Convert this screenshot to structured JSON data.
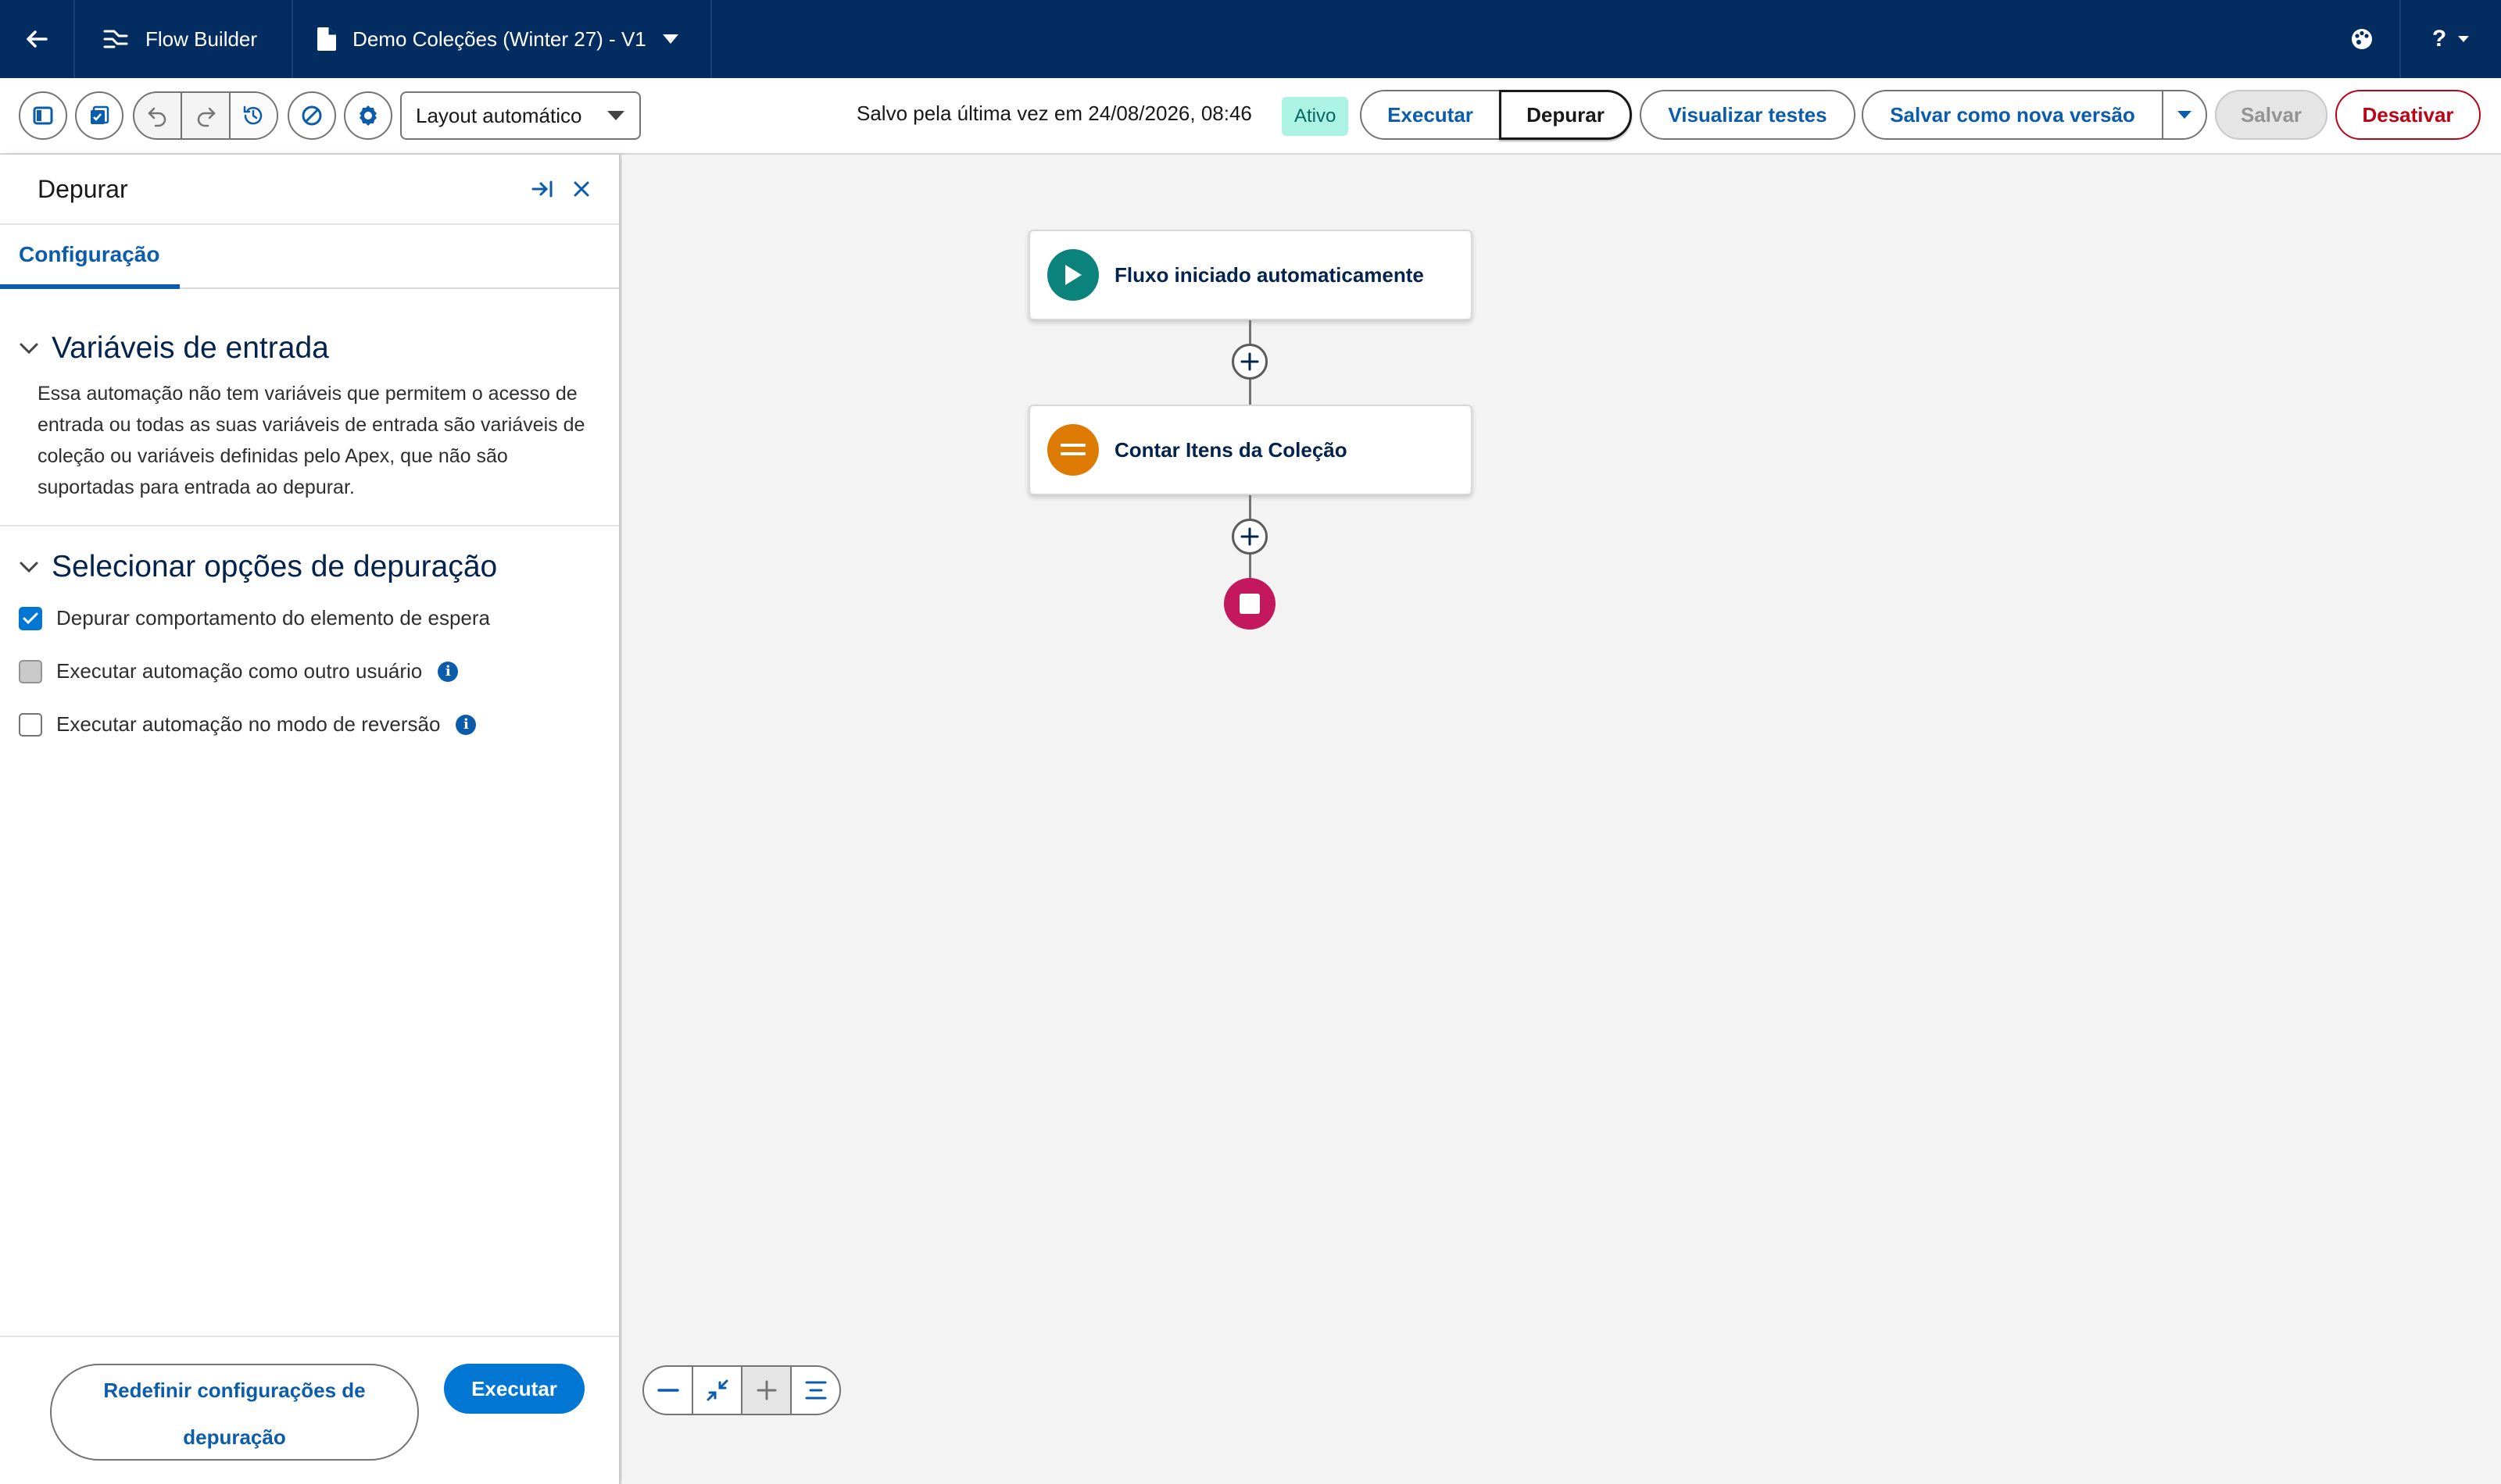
{
  "topbar": {
    "app_name": "Flow Builder",
    "flow_name": "Demo Coleções (Winter 27) - V1",
    "help_label": "?"
  },
  "toolbar": {
    "layout_select": "Layout automático",
    "saved_text": "Salvo pela última vez em 24/08/2026, 08:46",
    "status_badge": "Ativo",
    "run_label": "Executar",
    "debug_label": "Depurar",
    "view_tests_label": "Visualizar testes",
    "save_new_version_label": "Salvar como nova versão",
    "save_label": "Salvar",
    "deactivate_label": "Desativar"
  },
  "panel": {
    "title": "Depurar",
    "tab_label": "Configuração",
    "input_vars_title": "Variáveis de entrada",
    "input_vars_text": "Essa automação não tem variáveis que permitem o acesso de entrada ou todas as suas variáveis de entrada são variáveis de coleção ou variáveis definidas pelo Apex, que não são suportadas para entrada ao depurar.",
    "debug_options_title": "Selecionar opções de depuração",
    "options": [
      {
        "label": "Depurar comportamento do elemento de espera",
        "checked": true
      },
      {
        "label": "Executar automação como outro usuário",
        "checked": false
      },
      {
        "label": "Executar automação no modo de reversão",
        "checked": false
      }
    ],
    "reset_label": "Redefinir configurações de depuração",
    "run_label": "Executar"
  },
  "canvas": {
    "start_node_label": "Fluxo iniciado automaticamente",
    "assignment_node_label": "Contar Itens da Coleção"
  },
  "colors": {
    "header_bg": "#032d60",
    "brand_blue": "#0176d3",
    "link_blue": "#0b5cab",
    "start_node": "#0b827c",
    "assignment_node": "#dd7a01",
    "end_node": "#c3185d",
    "active_badge": "#acf3e4",
    "deactivate": "#ba0517"
  },
  "icons": [
    "back-arrow-icon",
    "flow-builder-icon",
    "document-icon",
    "chevron-down-icon",
    "palette-icon",
    "help-icon",
    "toggle-panel-icon",
    "save-icon",
    "undo-icon",
    "redo-icon",
    "history-icon",
    "error-icon",
    "settings-icon",
    "dock-icon",
    "close-icon",
    "play-icon",
    "assignment-icon",
    "stop-icon",
    "plus-icon",
    "zoom-out-icon",
    "fit-icon",
    "zoom-in-icon",
    "auto-align-icon",
    "info-icon"
  ]
}
